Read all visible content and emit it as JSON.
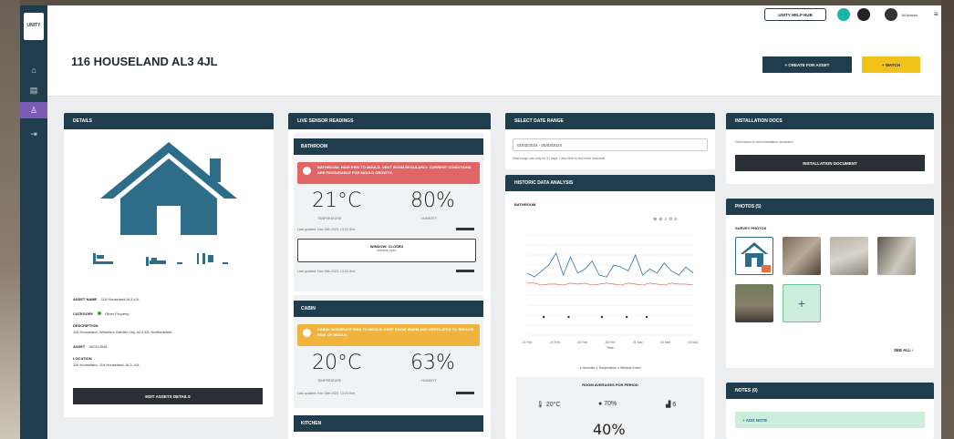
{
  "topbar": {
    "help_label": "UNITY HELP HUB",
    "user_label": "Jill Adams"
  },
  "page_title": "116 HOUSELAND AL3 4JL",
  "header_buttons": {
    "primary": "+ CREATE FOR ASSET",
    "secondary": "+ WATCH"
  },
  "details": {
    "header": "DETAILS",
    "asset_name_label": "ASSET NAME",
    "asset_name_value": "116 Houseland AL3 4JL",
    "category_label": "CATEGORY",
    "category_value": "Other Property",
    "description_label": "DESCRIPTION",
    "description_value": "116 Houseland, Wheelers Garden City, AL3 4JL Hertfordshire",
    "asset_label": "ASSET",
    "asset_value": "000113045",
    "location_label": "LOCATION",
    "location_value": "116 Houseland, 116 Houseland, AL3, 4JL",
    "button": "EDIT ASSETS DETAILS"
  },
  "sensors": {
    "header": "LIVE SENSOR READINGS",
    "rooms": [
      {
        "name": "BATHROOM",
        "alert": "BATHROOM: HIGH RISK TO MOULD. VENT ROOM REGULARLY. CURRENT CONDITIONS ARE FAVOURABLE FOR MOULD GROWTH.",
        "temperature": "21°C",
        "temperature_caption": "TEMPERATURE",
        "humidity": "80%",
        "humidity_caption": "HUMIDITY",
        "updated": "Last updated: Nov 15th 2023, 13:23 Gmt",
        "window_label": "WINDOW: CLOSED",
        "window_sub": "Window open",
        "window_updated": "Last updated: Nov 15th 2023, 13:23 Gmt"
      },
      {
        "name": "CABIN",
        "alert": "CABIN: MODERATE RISK TO MOULD. KEEP ROOM WARM AND VENTILATED TO REDUCE RISK OF MOULD.",
        "temperature": "20°C",
        "temperature_caption": "TEMPERATURE",
        "humidity": "63%",
        "humidity_caption": "HUMIDITY",
        "updated": "Last updated: Nov 15th 2023, 13:23 Gmt"
      },
      {
        "name": "KITCHEN"
      }
    ]
  },
  "date_range": {
    "header": "SELECT DATE RANGE",
    "value": "01/03/2024 - 05/03/2024",
    "hint": "Date range can only be 31 days. Click here to find more historical"
  },
  "historic": {
    "header": "HISTORIC DATA ANALYSIS",
    "room": "BATHROOM",
    "x_label": "Time",
    "legend": [
      "Humidity",
      "Temperature",
      "Window Event"
    ],
    "legend_colors": [
      "#2e6fb4",
      "#d9534f",
      "#3a9a4a"
    ],
    "averages_title": "ROOM AVERAGES FOR PERIOD",
    "temp_avg": "20°C",
    "hum_avg": "70%",
    "window_avg": "6",
    "bottom_value": "40%"
  },
  "chart_data": {
    "type": "line",
    "x": [
      "22 Feb",
      "24 Feb",
      "26 Feb",
      "28 Feb",
      "01 Mar",
      "03 Mar",
      "05 Mar"
    ],
    "series": [
      {
        "name": "Humidity",
        "values": [
          62,
          58,
          64,
          70,
          82,
          60,
          78,
          62,
          66,
          74,
          60,
          58,
          70,
          68,
          64,
          80,
          60,
          66,
          62,
          72,
          64,
          60,
          68,
          62
        ]
      },
      {
        "name": "Temperature",
        "values": [
          52,
          52,
          50,
          51,
          51,
          50,
          52,
          51,
          52,
          50,
          51,
          52,
          51,
          50,
          52,
          51,
          50,
          52,
          51,
          50,
          52,
          51,
          51,
          50
        ]
      }
    ]
  },
  "installation": {
    "header": "INSTALLATION DOCS",
    "hint": "Click below to view installation document",
    "button": "INSTALLATION DOCUMENT"
  },
  "photos": {
    "header": "PHOTOS (5)",
    "section": "SURVEY PHOTOS",
    "add_symbol": "+",
    "see_all": "SEE ALL"
  },
  "notes": {
    "header": "NOTES (0)",
    "add": "+ ADD NOTE"
  }
}
